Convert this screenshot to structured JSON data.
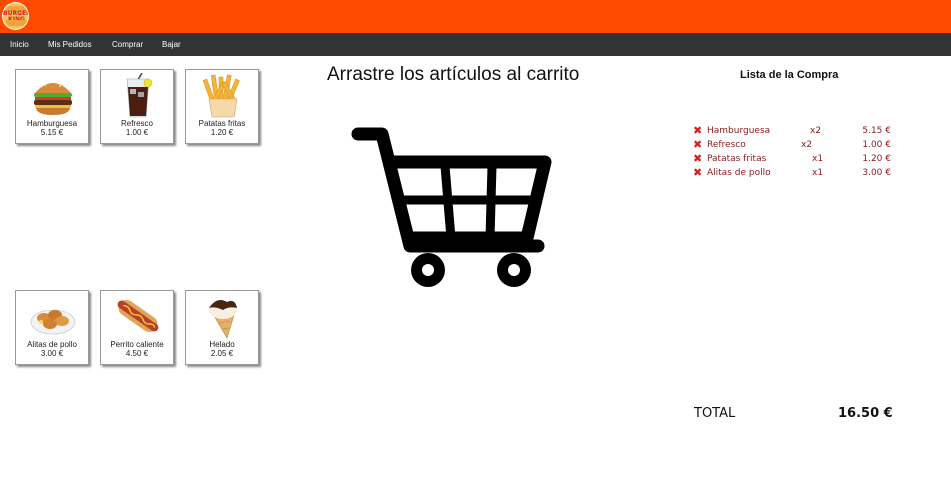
{
  "header": {
    "logo_text": "BURGER KING",
    "accent_color": "#ff4a00",
    "nav_color": "#333333"
  },
  "nav": {
    "items": [
      {
        "label": "Inicio"
      },
      {
        "label": "Mis Pedidos"
      },
      {
        "label": "Comprar"
      },
      {
        "label": "Bajar"
      }
    ]
  },
  "products": [
    {
      "name": "Hamburguesa",
      "price": "5.15 €",
      "icon": "hamburger-icon"
    },
    {
      "name": "Refresco",
      "price": "1.00 €",
      "icon": "soda-icon"
    },
    {
      "name": "Patatas fritas",
      "price": "1.20 €",
      "icon": "fries-icon"
    },
    {
      "name": "Alitas de pollo",
      "price": "3.00 €",
      "icon": "chicken-wings-icon"
    },
    {
      "name": "Perrito caliente",
      "price": "4.50 €",
      "icon": "hotdog-icon"
    },
    {
      "name": "Helado",
      "price": "2.05 €",
      "icon": "ice-cream-icon"
    }
  ],
  "main": {
    "headline": "Arrastre los artículos al carrito",
    "cart_icon": "shopping-cart-icon"
  },
  "cart": {
    "title": "Lista de la Compra",
    "remove_icon": "remove-x-icon",
    "items": [
      {
        "name": "Hamburguesa",
        "qty": "x2",
        "price": "5.15 €"
      },
      {
        "name": "Refresco",
        "qty": "x2",
        "price": "1.00 €"
      },
      {
        "name": "Patatas fritas",
        "qty": "x1",
        "price": "1.20 €"
      },
      {
        "name": "Alitas de pollo",
        "qty": "x1",
        "price": "3.00 €"
      }
    ],
    "total_label": "TOTAL",
    "total_value": "16.50 €"
  }
}
